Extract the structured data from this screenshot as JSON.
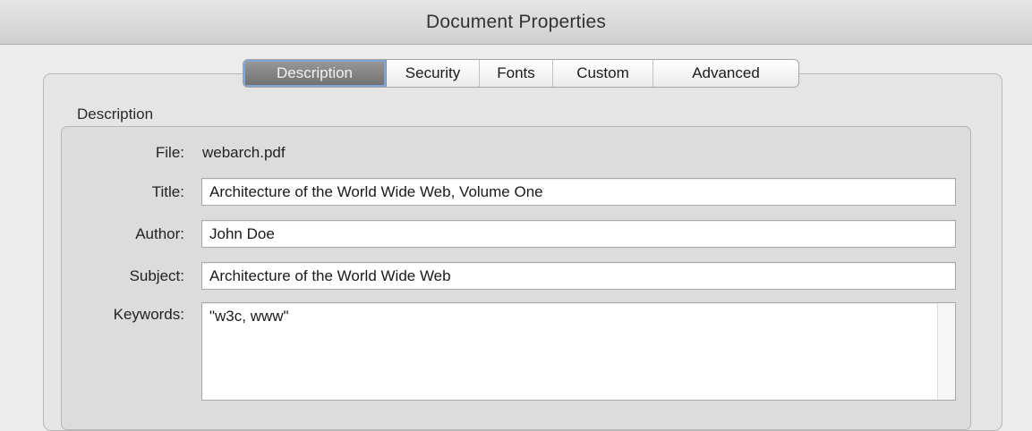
{
  "window": {
    "title": "Document Properties"
  },
  "tabs": [
    {
      "label": "Description",
      "active": true
    },
    {
      "label": "Security",
      "active": false
    },
    {
      "label": "Fonts",
      "active": false
    },
    {
      "label": "Custom",
      "active": false
    },
    {
      "label": "Advanced",
      "active": false
    }
  ],
  "section": {
    "label": "Description"
  },
  "fields": {
    "file": {
      "label": "File:",
      "value": "webarch.pdf"
    },
    "title": {
      "label": "Title:",
      "value": "Architecture of the World Wide Web, Volume One"
    },
    "author": {
      "label": "Author:",
      "value": "John Doe"
    },
    "subject": {
      "label": "Subject:",
      "value": "Architecture of the World Wide Web"
    },
    "keywords": {
      "label": "Keywords:",
      "value": "\"w3c, www\""
    }
  },
  "colors": {
    "active_tab_focus_ring": "#7fa6d8",
    "panel_background": "#dcdcdc",
    "window_background": "#ececec"
  }
}
